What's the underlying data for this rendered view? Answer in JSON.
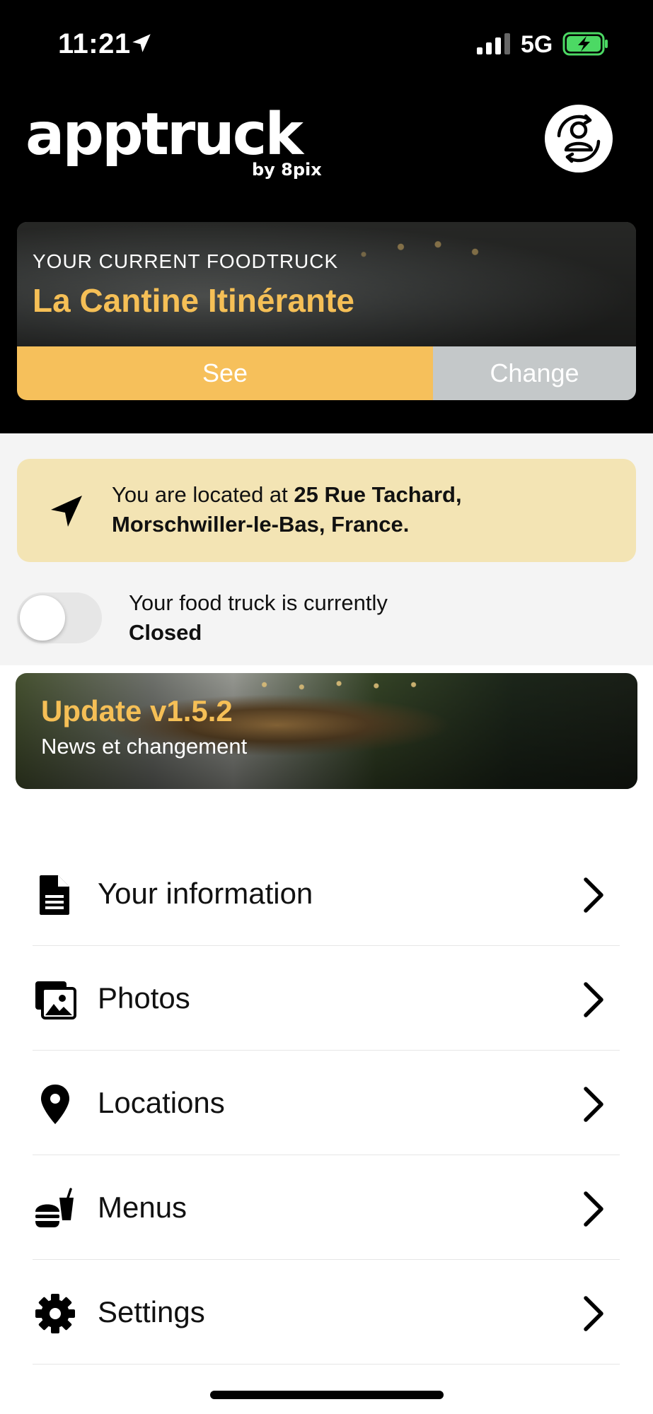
{
  "status_bar": {
    "time": "11:21",
    "network": "5G",
    "icons": [
      "location-arrow-icon",
      "signal-bars-icon",
      "battery-charging-icon"
    ]
  },
  "brand": {
    "logo": "apptruck",
    "by": "by 8pix"
  },
  "profile_button_icon": "user-switch-icon",
  "current_truck": {
    "label": "YOUR CURRENT FOODTRUCK",
    "name": "La Cantine Itinérante",
    "see_label": "See",
    "change_label": "Change"
  },
  "location": {
    "prefix": "You are located at ",
    "address": "25 Rue Tachard, Morschwiller-le-Bas, France.",
    "icon": "navigation-arrow-icon"
  },
  "status_toggle": {
    "text": "Your food truck is currently",
    "state": "Closed",
    "is_on": false
  },
  "update_banner": {
    "title": "Update v1.5.2",
    "subtitle": "News et changement"
  },
  "menu": [
    {
      "label": "Your information",
      "icon": "document-icon"
    },
    {
      "label": "Photos",
      "icon": "photos-icon"
    },
    {
      "label": "Locations",
      "icon": "map-pin-icon"
    },
    {
      "label": "Menus",
      "icon": "burger-drink-icon"
    },
    {
      "label": "Settings",
      "icon": "gear-icon"
    }
  ],
  "colors": {
    "accent": "#f6c05b",
    "accent_text": "#f5bf56",
    "change_button": "#c4c8c9",
    "location_card": "#f3e4b4",
    "header_bg": "#000000"
  }
}
